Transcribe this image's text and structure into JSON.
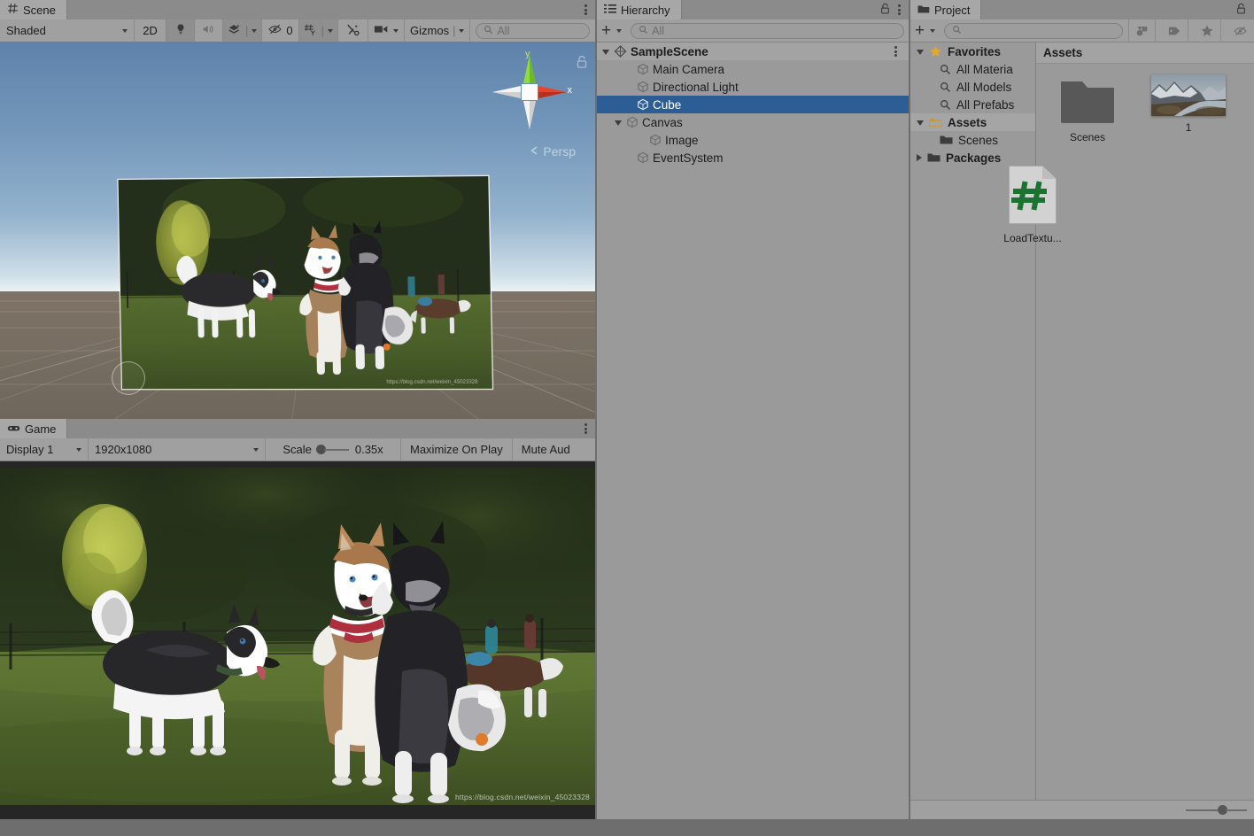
{
  "scene_view": {
    "tab_label": "Scene",
    "tab_icon": "grid-hash-icon",
    "menu_icon": "kebab-menu-icon",
    "toolbar": {
      "shading_mode": "Shaded",
      "mode_2d": "2D",
      "lighting_icon": "light-bulb-icon",
      "audio_icon": "speaker-icon",
      "fx_icon": "effects-layers-icon",
      "visibility_icon": "eye-crossed-icon",
      "hidden_count": "0",
      "grid_icon": "grid-axis-icon",
      "tools_icon": "tools-icon",
      "camera_icon": "scene-camera-icon",
      "gizmos_label": "Gizmos",
      "search_placeholder": "All",
      "search_icon": "search-icon"
    },
    "gizmo": {
      "y_label": "y",
      "x_label": "x",
      "projection": "Persp",
      "projection_icon": "chevron-left-icon",
      "lock_icon": "padlock-icon"
    }
  },
  "game_view": {
    "tab_label": "Game",
    "tab_icon": "gamepad-icon",
    "menu_icon": "kebab-menu-icon",
    "toolbar": {
      "display": "Display 1",
      "resolution": "1920x1080",
      "scale_label": "Scale",
      "scale_value": "0.35x",
      "maximize_on_play": "Maximize On Play",
      "mute_audio": "Mute Aud"
    },
    "watermark": "https://blog.csdn.net/weixin_45023328"
  },
  "hierarchy": {
    "tab_label": "Hierarchy",
    "tab_icon": "hierarchy-list-icon",
    "lock_icon": "padlock-icon",
    "menu_icon": "kebab-menu-icon",
    "toolbar": {
      "add_label": "+",
      "search_placeholder": "All",
      "search_icon": "search-icon"
    },
    "items": [
      {
        "label": "SampleScene",
        "depth": 0,
        "icon": "scene-icon",
        "expanded": true,
        "selected": false,
        "bold": true
      },
      {
        "label": "Main Camera",
        "depth": 2,
        "icon": "gameobject-icon",
        "expanded": null,
        "selected": false,
        "bold": false
      },
      {
        "label": "Directional Light",
        "depth": 2,
        "icon": "gameobject-icon",
        "expanded": null,
        "selected": false,
        "bold": false
      },
      {
        "label": "Cube",
        "depth": 2,
        "icon": "gameobject-icon",
        "expanded": null,
        "selected": true,
        "bold": false
      },
      {
        "label": "Canvas",
        "depth": 1,
        "icon": "gameobject-icon",
        "expanded": true,
        "selected": false,
        "bold": false
      },
      {
        "label": "Image",
        "depth": 3,
        "icon": "gameobject-icon",
        "expanded": null,
        "selected": false,
        "bold": false
      },
      {
        "label": "EventSystem",
        "depth": 2,
        "icon": "gameobject-icon",
        "expanded": null,
        "selected": false,
        "bold": false
      }
    ]
  },
  "project": {
    "tab_label": "Project",
    "tab_icon": "folder-icon",
    "lock_icon": "padlock-icon",
    "toolbar": {
      "add_label": "+",
      "search_placeholder": "",
      "search_icon": "search-icon",
      "filter_type_icon": "filter-by-type-icon",
      "filter_label_icon": "label-tag-icon",
      "favorite_icon": "star-icon",
      "visibility_icon": "eye-crossed-icon"
    },
    "tree": [
      {
        "label": "Favorites",
        "depth": 0,
        "icon": "star-icon",
        "expanded": true,
        "bold": true,
        "highlight": false
      },
      {
        "label": "All Materia",
        "depth": 1,
        "icon": "search-icon",
        "expanded": null,
        "bold": false,
        "highlight": false
      },
      {
        "label": "All Models",
        "depth": 1,
        "icon": "search-icon",
        "expanded": null,
        "bold": false,
        "highlight": false
      },
      {
        "label": "All Prefabs",
        "depth": 1,
        "icon": "search-icon",
        "expanded": null,
        "bold": false,
        "highlight": false
      },
      {
        "label": "Assets",
        "depth": 0,
        "icon": "folder-open-icon",
        "expanded": true,
        "bold": true,
        "highlight": true
      },
      {
        "label": "Scenes",
        "depth": 1,
        "icon": "folder-icon",
        "expanded": null,
        "bold": false,
        "highlight": false
      },
      {
        "label": "Packages",
        "depth": 0,
        "icon": "folder-icon",
        "expanded": false,
        "bold": true,
        "highlight": false
      }
    ],
    "breadcrumb": "Assets",
    "assets": [
      {
        "label": "Scenes",
        "kind": "folder"
      },
      {
        "label": "1",
        "kind": "texture"
      },
      {
        "label": "LoadTextu...",
        "kind": "csharp-script"
      }
    ],
    "zoom_slider_icon": "zoom-slider"
  },
  "colors": {
    "selection_blue": "#2c5d94",
    "panel_bg": "#9a9a9a",
    "toolbar_bg": "#a0a0a0",
    "favorite_star": "#e0a92c",
    "csharp_green": "#1c7230"
  }
}
